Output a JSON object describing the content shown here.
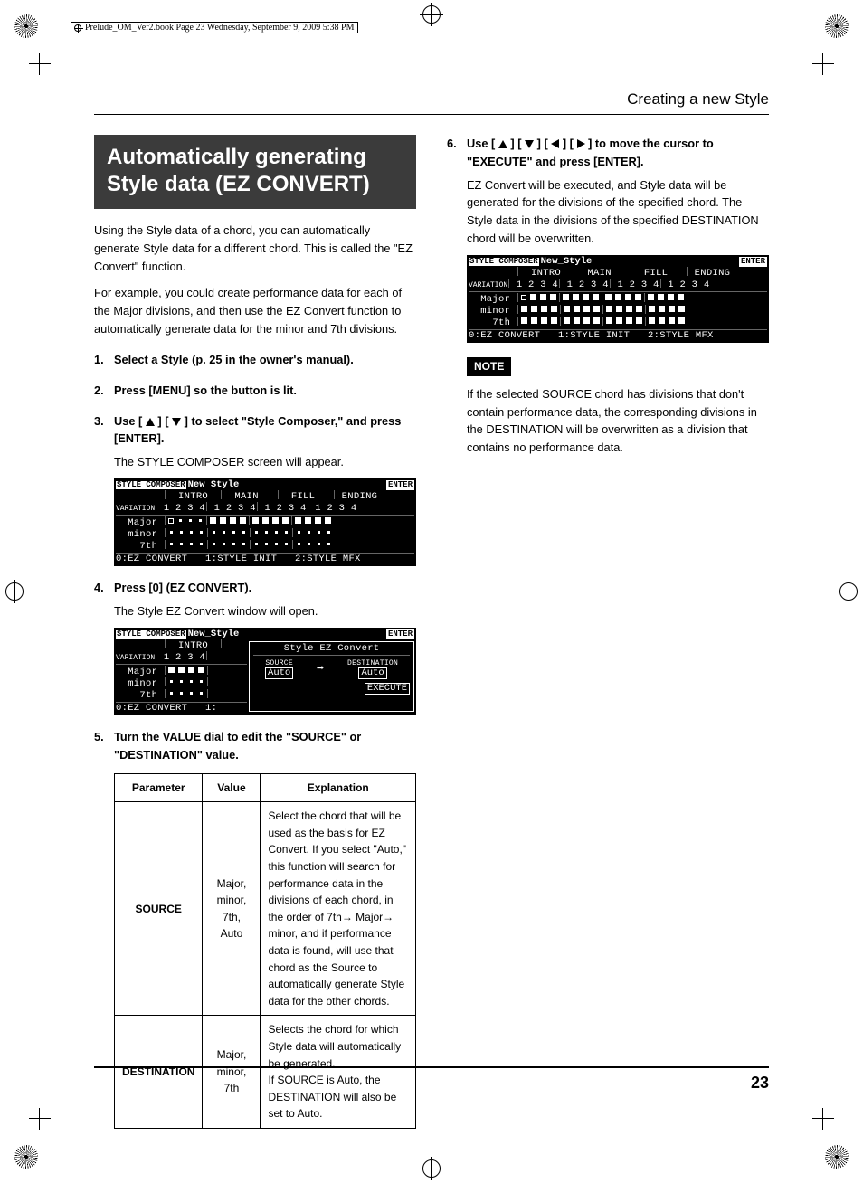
{
  "print_meta": {
    "tagline": "Prelude_OM_Ver2.book  Page 23  Wednesday, September 9, 2009  5:38 PM"
  },
  "header": {
    "running": "Creating a new Style"
  },
  "section": {
    "title_line1": "Automatically generating",
    "title_line2": "Style data (EZ CONVERT)"
  },
  "intro": {
    "p1": "Using the Style data of a chord, you can automatically generate Style data for a different chord. This is called the \"EZ Convert\" function.",
    "p2": "For example, you could create performance data for each of the Major divisions, and then use the EZ Convert function to automatically generate data for the minor and 7th divisions."
  },
  "steps": {
    "s1": {
      "num": "1.",
      "text": "Select a Style (p. 25 in the owner's manual)."
    },
    "s2": {
      "num": "2.",
      "text": "Press [MENU] so the button is lit."
    },
    "s3": {
      "num": "3.",
      "prefix": "Use [",
      "mid1": "] [",
      "suffix": "] to select \"Style Composer,\" and press [ENTER].",
      "after": "The STYLE COMPOSER screen will appear."
    },
    "s4": {
      "num": "4.",
      "text": "Press [0] (EZ CONVERT).",
      "after": "The Style EZ Convert window will open."
    },
    "s5": {
      "num": "5.",
      "text": "Turn the VALUE dial to edit the \"SOURCE\" or \"DESTINATION\" value."
    },
    "s6": {
      "num": "6.",
      "prefix": "Use [",
      "mid": "] [",
      "suffix1": "] [",
      "suffix2": "] [",
      "suffix3": "] to move the cursor to \"EXECUTE\" and press [ENTER].",
      "after": "EZ Convert will be executed, and Style data will be generated for the divisions of the specified chord. The Style data in the divisions of the specified DESTINATION chord will be overwritten."
    }
  },
  "lcd1": {
    "hdr_left": "STYLE COMPOSER",
    "hdr_title": "New_Style",
    "hdr_right": "ENTER",
    "cols": [
      "INTRO",
      "MAIN",
      "FILL",
      "ENDING"
    ],
    "var_label": "VARIATION",
    "nums": "1 2 3 4",
    "rows": [
      "Major",
      "minor",
      "7th"
    ],
    "foot": "0:EZ CONVERT   1:STYLE INIT   2:STYLE MFX"
  },
  "lcd2": {
    "popup_title": "Style EZ Convert",
    "src_label": "SOURCE",
    "dst_label": "DESTINATION",
    "src_val": "Auto",
    "dst_val": "Auto",
    "exec": "EXECUTE",
    "foot_left": "0:EZ CONVERT   1:"
  },
  "table": {
    "h1": "Parameter",
    "h2": "Value",
    "h3": "Explanation",
    "r1": {
      "p": "SOURCE",
      "v": "Major, minor, 7th, Auto",
      "e": "Select the chord that will be used as the basis for EZ Convert. If you select \"Auto,\" this function will search for performance data in the divisions of each chord, in the order of 7th→ Major→ minor, and if performance data is found, will use that chord as the Source to automatically generate Style data for the other chords."
    },
    "r2": {
      "p": "DESTINATION",
      "v": "Major, minor, 7th",
      "e": "Selects the chord for which Style data will automatically be generated.\nIf SOURCE is Auto, the DESTINATION will also be set to Auto."
    }
  },
  "note": {
    "label": "NOTE",
    "text": "If the selected SOURCE chord has divisions that don't contain performance data, the corresponding divisions in the DESTINATION will be overwritten as a division that contains no performance data."
  },
  "footer": {
    "page": "23"
  }
}
